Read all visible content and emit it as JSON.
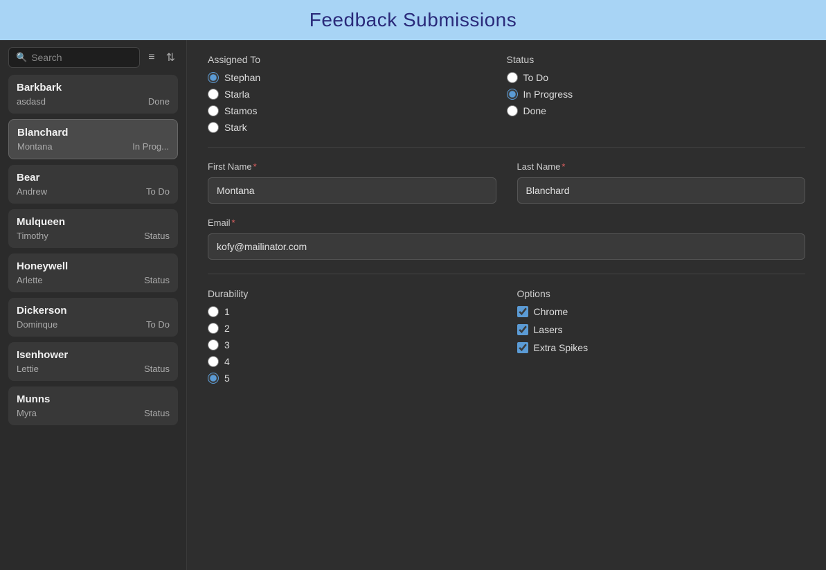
{
  "header": {
    "title": "Feedback Submissions"
  },
  "sidebar": {
    "search_placeholder": "Search",
    "items": [
      {
        "id": 1,
        "last_name": "Barkbark",
        "first_name": "asdasd",
        "status": "Done"
      },
      {
        "id": 2,
        "last_name": "Blanchard",
        "first_name": "Montana",
        "status": "In Prog...",
        "active": true
      },
      {
        "id": 3,
        "last_name": "Bear",
        "first_name": "Andrew",
        "status": "To Do"
      },
      {
        "id": 4,
        "last_name": "Mulqueen",
        "first_name": "Timothy",
        "status": "Status"
      },
      {
        "id": 5,
        "last_name": "Honeywell",
        "first_name": "Arlette",
        "status": "Status"
      },
      {
        "id": 6,
        "last_name": "Dickerson",
        "first_name": "Dominque",
        "status": "To Do"
      },
      {
        "id": 7,
        "last_name": "Isenhower",
        "first_name": "Lettie",
        "status": "Status"
      },
      {
        "id": 8,
        "last_name": "Munns",
        "first_name": "Myra",
        "status": "Status"
      }
    ]
  },
  "filters": {
    "assigned_to_label": "Assigned To",
    "assigned_options": [
      {
        "value": "Stephan",
        "checked": true
      },
      {
        "value": "Starla",
        "checked": false
      },
      {
        "value": "Stamos",
        "checked": false
      },
      {
        "value": "Stark",
        "checked": false
      }
    ],
    "status_label": "Status",
    "status_options": [
      {
        "value": "To Do",
        "checked": false
      },
      {
        "value": "In Progress",
        "checked": true
      },
      {
        "value": "Done",
        "checked": false
      }
    ]
  },
  "form": {
    "first_name_label": "First Name",
    "last_name_label": "Last Name",
    "email_label": "Email",
    "durability_label": "Durability",
    "options_label": "Options",
    "first_name_value": "Montana",
    "last_name_value": "Blanchard",
    "email_value": "kofy@mailinator.com",
    "durability_options": [
      {
        "value": "1",
        "checked": false
      },
      {
        "value": "2",
        "checked": false
      },
      {
        "value": "3",
        "checked": false
      },
      {
        "value": "4",
        "checked": false
      },
      {
        "value": "5",
        "checked": true
      }
    ],
    "options_checkboxes": [
      {
        "value": "Chrome",
        "checked": true
      },
      {
        "value": "Lasers",
        "checked": true
      },
      {
        "value": "Extra Spikes",
        "checked": true
      }
    ]
  },
  "icons": {
    "search": "🔍",
    "filter": "≡",
    "sort": "⇅"
  }
}
